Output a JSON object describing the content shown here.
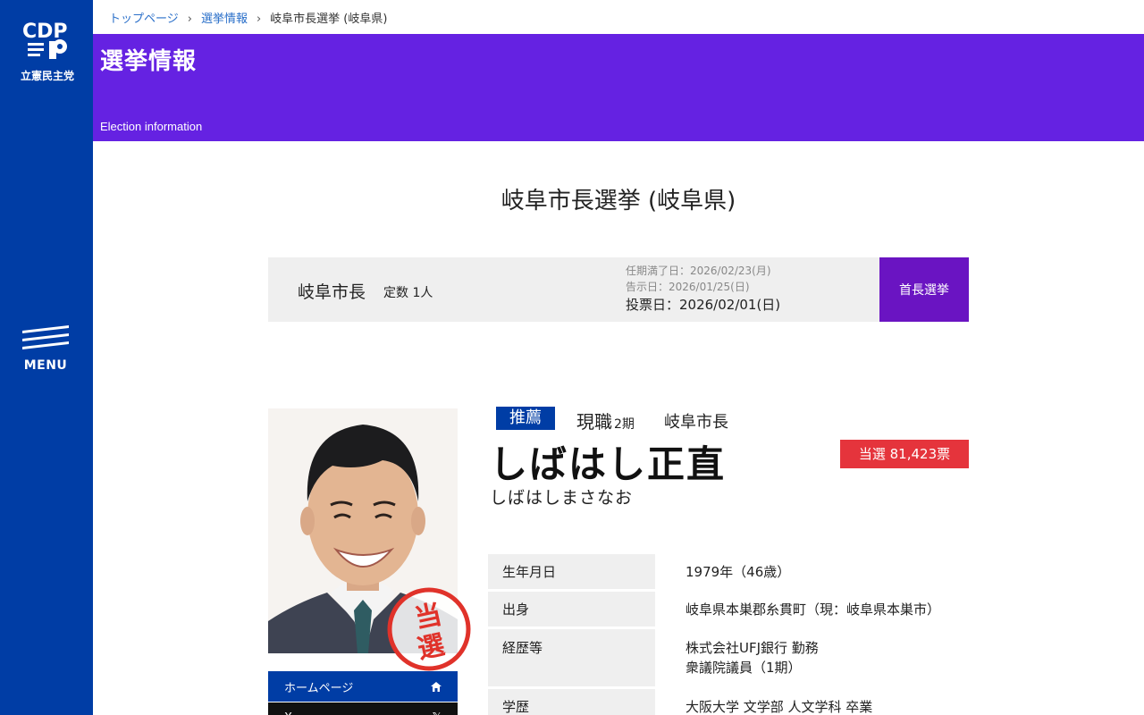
{
  "sidebar": {
    "logo_letters": "CDP",
    "logo_text": "立憲民主党",
    "menu_label": "MENU"
  },
  "breadcrumb": {
    "items": [
      "トップページ",
      "選挙情報",
      "岐阜市長選挙 (岐阜県)"
    ]
  },
  "hero": {
    "title": "選挙情報",
    "subtitle": "Election information"
  },
  "page_title": "岐阜市長選挙 (岐阜県)",
  "summary": {
    "name": "岐阜市長",
    "seats": "定数 1人",
    "term_end": "任期満了日：2026/02/23(月)",
    "announce": "告示日：2026/01/25(日)",
    "vote": "投票日：2026/02/01(日)",
    "type": "首長選挙"
  },
  "candidate": {
    "badge": "推薦",
    "status": "現職",
    "term": "2期",
    "office": "岐阜市長",
    "name": "しばはし正直",
    "kana": "しばはしまさなお",
    "result": "当選 81,423票",
    "stamp": "当選",
    "links": {
      "home": "ホームページ",
      "x": "X"
    },
    "profile": [
      {
        "label": "生年月日",
        "value": "1979年（46歳）"
      },
      {
        "label": "出身",
        "value": "岐阜県本巣郡糸貫町（現：岐阜県本巣市）"
      },
      {
        "label": "経歴等",
        "value": "株式会社UFJ銀行 勤務",
        "value2": "衆議院議員（1期）"
      },
      {
        "label": "学歴",
        "value": "大阪大学 文学部 人文学科 卒業"
      }
    ]
  },
  "colors": {
    "sidebar": "#003da5",
    "hero": "#6522e2",
    "type_button": "#6a14c2",
    "result": "#e5343c"
  }
}
